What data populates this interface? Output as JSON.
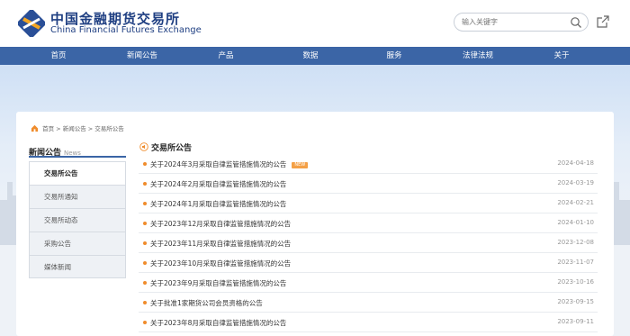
{
  "header": {
    "logo_cn": "中国金融期货交易所",
    "logo_en": "China Financial Futures Exchange",
    "search_placeholder": "输入关键字"
  },
  "nav": {
    "items": [
      {
        "label": "首页"
      },
      {
        "label": "新闻公告"
      },
      {
        "label": "产品"
      },
      {
        "label": "数据"
      },
      {
        "label": "服务"
      },
      {
        "label": "法律法规"
      },
      {
        "label": "关于"
      }
    ]
  },
  "breadcrumb": {
    "home": "首页",
    "sep1": ">",
    "news": "新闻公告",
    "sep2": ">",
    "current": "交易所公告"
  },
  "sidebar": {
    "title": "新闻公告",
    "title_en": "News",
    "items": [
      {
        "label": "交易所公告",
        "active": true
      },
      {
        "label": "交易所通知",
        "active": false
      },
      {
        "label": "交易所动态",
        "active": false
      },
      {
        "label": "采购公告",
        "active": false
      },
      {
        "label": "媒体新闻",
        "active": false
      }
    ]
  },
  "list": {
    "title": "交易所公告",
    "new_badge": "NEW",
    "items": [
      {
        "title": "关于2024年3月采取自律监管措施情况的公告",
        "date": "2024-04-18",
        "is_new": true
      },
      {
        "title": "关于2024年2月采取自律监管措施情况的公告",
        "date": "2024-03-19",
        "is_new": false
      },
      {
        "title": "关于2024年1月采取自律监管措施情况的公告",
        "date": "2024-02-21",
        "is_new": false
      },
      {
        "title": "关于2023年12月采取自律监管措施情况的公告",
        "date": "2024-01-10",
        "is_new": false
      },
      {
        "title": "关于2023年11月采取自律监管措施情况的公告",
        "date": "2023-12-08",
        "is_new": false
      },
      {
        "title": "关于2023年10月采取自律监管措施情况的公告",
        "date": "2023-11-07",
        "is_new": false
      },
      {
        "title": "关于2023年9月采取自律监管措施情况的公告",
        "date": "2023-10-16",
        "is_new": false
      },
      {
        "title": "关于批准1家期货公司会员资格的公告",
        "date": "2023-09-15",
        "is_new": false
      },
      {
        "title": "关于2023年8月采取自律监管措施情况的公告",
        "date": "2023-09-11",
        "is_new": false
      }
    ]
  },
  "colors": {
    "nav_bg": "#3b65a6",
    "brand_blue": "#1f3f82",
    "bullet_orange": "#f08c2c",
    "badge_orange": "#f4a046"
  }
}
